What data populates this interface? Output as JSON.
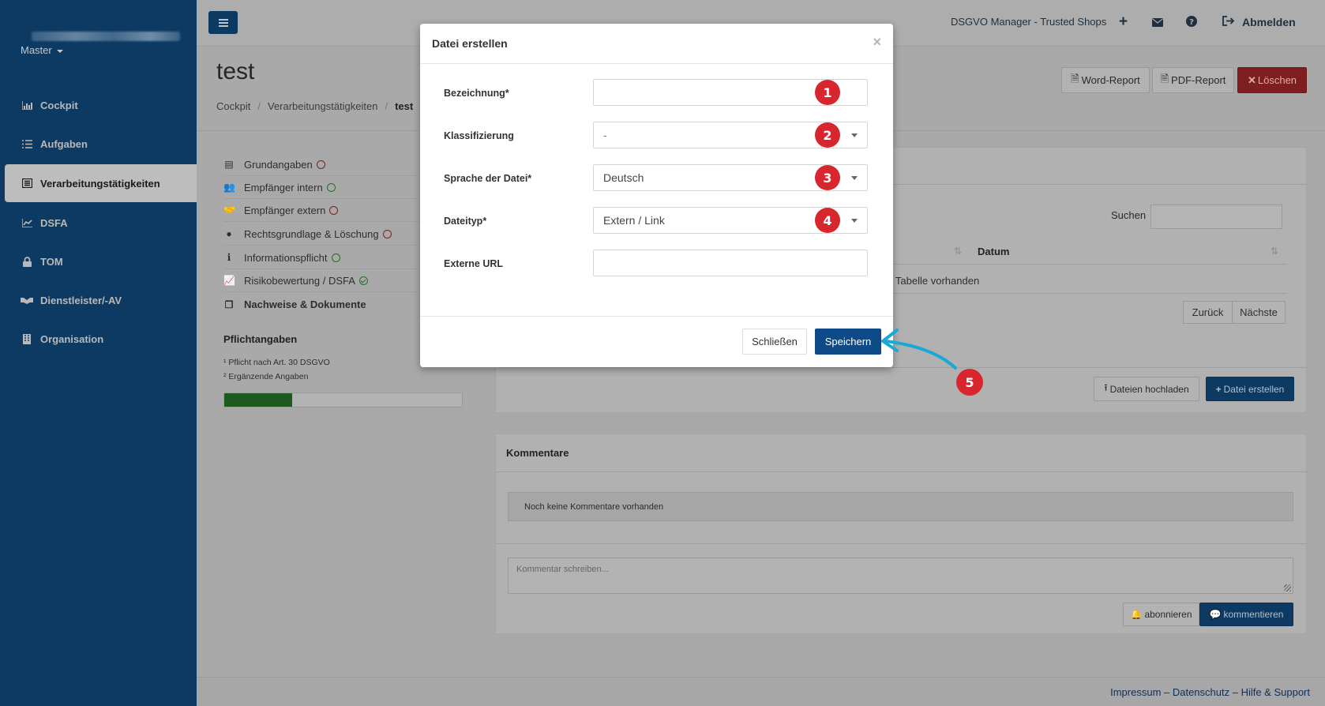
{
  "sidebar": {
    "master": "Master",
    "items": [
      {
        "label": "Cockpit",
        "icon": "chart-area-icon"
      },
      {
        "label": "Aufgaben",
        "icon": "tasks-icon"
      },
      {
        "label": "Verarbeitungstätigkeiten",
        "icon": "list-alt-icon"
      },
      {
        "label": "DSFA",
        "icon": "chart-line-icon"
      },
      {
        "label": "TOM",
        "icon": "lock-icon"
      },
      {
        "label": "Dienstleister/-AV",
        "icon": "handshake-icon"
      },
      {
        "label": "Organisation",
        "icon": "building-icon"
      }
    ]
  },
  "topbar": {
    "brand": "DSGVO Manager - Trusted Shops",
    "logout": "Abmelden"
  },
  "page": {
    "title": "test",
    "breadcrumb": [
      "Cockpit",
      "Verarbeitungstätigkeiten",
      "test"
    ],
    "word_report": "Word-Report",
    "pdf_report": "PDF-Report",
    "delete": "Löschen"
  },
  "subnav": [
    {
      "label": "Grundangaben",
      "status": "red"
    },
    {
      "label": "Empfänger intern",
      "status": "green"
    },
    {
      "label": "Empfänger extern",
      "status": "red"
    },
    {
      "label": "Rechtsgrundlage & Löschung",
      "status": "red"
    },
    {
      "label": "Informationspflicht",
      "status": "green"
    },
    {
      "label": "Risikobewertung / DSFA",
      "status": "check"
    },
    {
      "label": "Nachweise & Dokumente",
      "status": "none"
    }
  ],
  "pflicht": {
    "title": "Pflichtangaben",
    "note1": "¹ Pflicht nach Art. 30 DSGVO",
    "note2": "² Ergänzende Angaben",
    "progress": 0.285
  },
  "docs": {
    "search_label": "Suchen",
    "col_datum": "Datum",
    "empty": "er Tabelle vorhanden",
    "back": "Zurück",
    "next": "Nächste",
    "upload": "Dateien hochladen",
    "create": "Datei erstellen"
  },
  "comments": {
    "title": "Kommentare",
    "empty": "Noch keine Kommentare vorhanden",
    "placeholder": "Kommentar schreiben...",
    "subscribe": "abonnieren",
    "comment": "kommentieren"
  },
  "footer": {
    "links": "Impressum – Datenschutz – Hilfe & Support"
  },
  "modal": {
    "title": "Datei erstellen",
    "fields": [
      {
        "label": "Bezeichnung*",
        "value": "",
        "badge": "1"
      },
      {
        "label": "Klassifizierung",
        "value": "-",
        "badge": "2"
      },
      {
        "label": "Sprache der Datei*",
        "value": "Deutsch",
        "badge": "3"
      },
      {
        "label": "Dateityp*",
        "value": "Extern / Link",
        "badge": "4"
      },
      {
        "label": "Externe URL",
        "value": ""
      }
    ],
    "close": "Schließen",
    "save": "Speichern"
  },
  "annotation": {
    "step5": "5"
  },
  "colors": {
    "accent": "#0e4a88",
    "badge": "#d8262f",
    "arrow": "#19a9d9",
    "sidebar": "#0d3a63"
  }
}
